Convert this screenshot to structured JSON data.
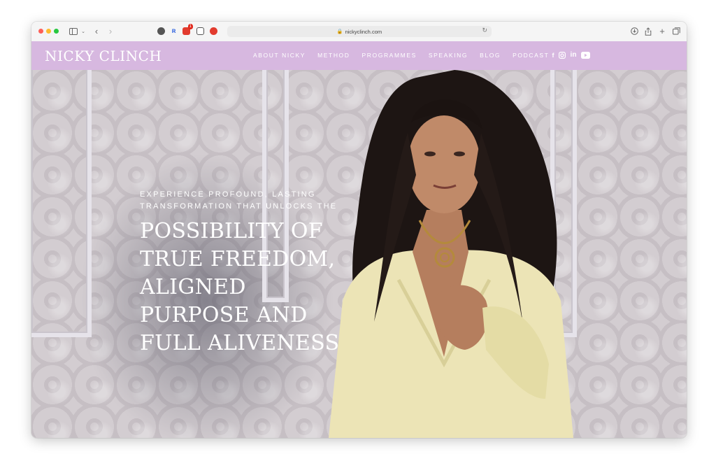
{
  "browser": {
    "url": "nickyclinch.com",
    "extension_badge": "1"
  },
  "site": {
    "logo": "NICKY CLINCH",
    "brand_color": "#d7b8e0",
    "nav": [
      {
        "label": "ABOUT NICKY"
      },
      {
        "label": "METHOD"
      },
      {
        "label": "PROGRAMMES"
      },
      {
        "label": "SPEAKING"
      },
      {
        "label": "BLOG"
      },
      {
        "label": "PODCAST"
      }
    ],
    "social": [
      {
        "icon": "facebook-icon",
        "glyph": "f"
      },
      {
        "icon": "instagram-icon",
        "glyph": "◎"
      },
      {
        "icon": "linkedin-icon",
        "glyph": "in"
      },
      {
        "icon": "youtube-icon",
        "glyph": "▶"
      }
    ]
  },
  "hero": {
    "eyebrow": "EXPERIENCE PROFOUND, LASTING TRANSFORMATION THAT UNLOCKS THE",
    "headline": [
      "POSSIBILITY OF",
      "TRUE FREEDOM,",
      "ALIGNED",
      "PURPOSE AND",
      "FULL ALIVENESS"
    ]
  }
}
